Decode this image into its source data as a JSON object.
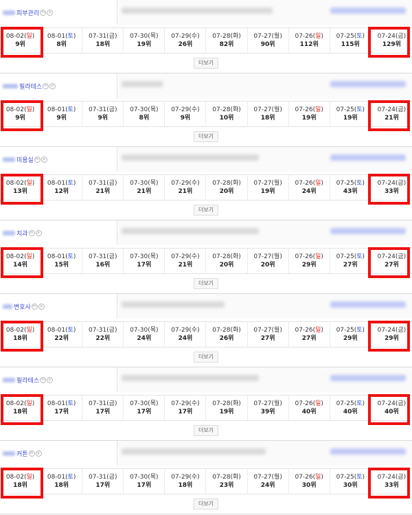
{
  "more_label": "더보기",
  "highlight_color": "#ee1111",
  "sunday_color": "#e0221b",
  "saturday_color": "#2a4fd6",
  "rank_suffix": "위",
  "dates": [
    {
      "md": "08-02",
      "wd": "일",
      "type": "sun"
    },
    {
      "md": "08-01",
      "wd": "토",
      "type": "sat"
    },
    {
      "md": "07-31",
      "wd": "금",
      "type": "norm"
    },
    {
      "md": "07-30",
      "wd": "목",
      "type": "norm"
    },
    {
      "md": "07-29",
      "wd": "수",
      "type": "norm"
    },
    {
      "md": "07-28",
      "wd": "화",
      "type": "norm"
    },
    {
      "md": "07-27",
      "wd": "월",
      "type": "norm"
    },
    {
      "md": "07-26",
      "wd": "일",
      "type": "sun"
    },
    {
      "md": "07-25",
      "wd": "토",
      "type": "sat"
    },
    {
      "md": "07-24",
      "wd": "금",
      "type": "norm"
    }
  ],
  "cards": [
    {
      "keyword": "피부관리",
      "ranks": [
        9,
        8,
        18,
        19,
        26,
        82,
        90,
        112,
        115,
        129
      ]
    },
    {
      "keyword": "필라테스",
      "ranks": [
        9,
        9,
        9,
        8,
        9,
        10,
        18,
        19,
        19,
        21
      ]
    },
    {
      "keyword": "미용실",
      "ranks": [
        13,
        12,
        21,
        21,
        21,
        20,
        19,
        24,
        43,
        33
      ]
    },
    {
      "keyword": "치과",
      "ranks": [
        14,
        15,
        16,
        17,
        21,
        20,
        20,
        29,
        27,
        27
      ]
    },
    {
      "keyword": "변호사",
      "ranks": [
        18,
        22,
        22,
        24,
        24,
        26,
        27,
        27,
        29,
        29
      ]
    },
    {
      "keyword": "필라테스",
      "ranks": [
        18,
        17,
        17,
        17,
        17,
        19,
        39,
        40,
        40,
        40
      ]
    },
    {
      "keyword": "커튼",
      "ranks": [
        18,
        18,
        17,
        17,
        18,
        23,
        24,
        30,
        30,
        33
      ]
    }
  ]
}
